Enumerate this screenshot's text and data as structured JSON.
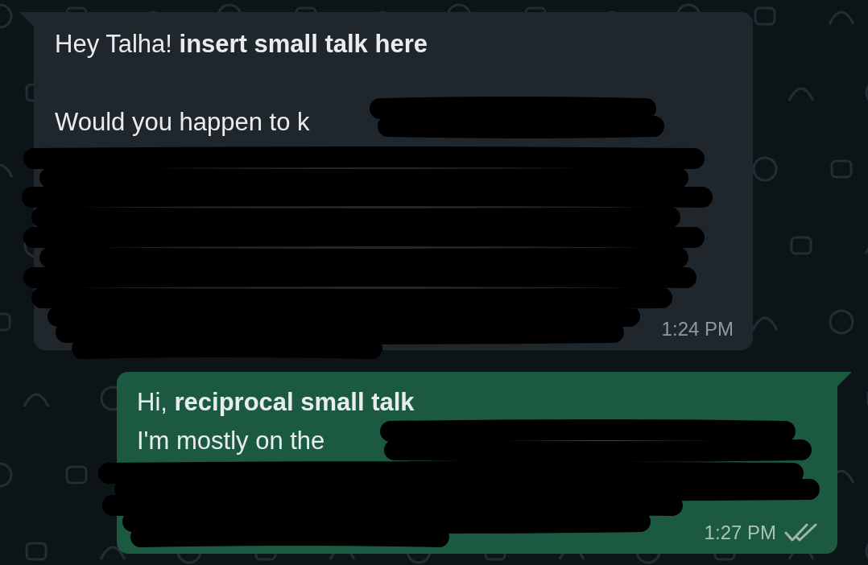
{
  "messages": [
    {
      "kind": "incoming",
      "lines": [
        "Hey Talha! **insert small talk here**",
        "Would you happen to k"
      ],
      "time": "1:24 PM",
      "redacted": true,
      "delivered": false
    },
    {
      "kind": "outgoing",
      "lines": [
        "Hi, **reciprocal small talk**",
        "I'm mostly on the"
      ],
      "time": "1:27 PM",
      "redacted": true,
      "delivered": true
    }
  ]
}
